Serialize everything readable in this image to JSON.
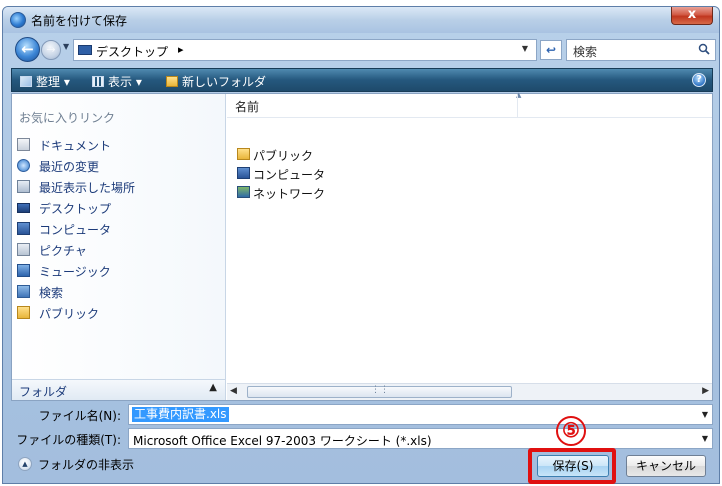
{
  "window": {
    "title": "名前を付けて保存",
    "close_label": "x"
  },
  "address": {
    "location": "デスクトップ",
    "search_placeholder": "検索"
  },
  "toolbar": {
    "organize": "整理",
    "view": "表示",
    "new_folder": "新しいフォルダ"
  },
  "navigation": {
    "header": "お気に入りリンク",
    "items": [
      {
        "label": "ドキュメント",
        "icon": "documents-icon"
      },
      {
        "label": "最近の変更",
        "icon": "recent-changes-icon"
      },
      {
        "label": "最近表示した場所",
        "icon": "recent-places-icon"
      },
      {
        "label": "デスクトップ",
        "icon": "desktop-icon"
      },
      {
        "label": "コンピュータ",
        "icon": "computer-icon"
      },
      {
        "label": "ピクチャ",
        "icon": "pictures-icon"
      },
      {
        "label": "ミュージック",
        "icon": "music-icon"
      },
      {
        "label": "検索",
        "icon": "search-icon"
      },
      {
        "label": "パブリック",
        "icon": "folder-icon"
      }
    ],
    "folders_label": "フォルダ"
  },
  "files": {
    "column_name": "名前",
    "items": [
      {
        "label": "パブリック",
        "icon": "folder-icon"
      },
      {
        "label": "コンピュータ",
        "icon": "computer-icon"
      },
      {
        "label": "ネットワーク",
        "icon": "network-icon"
      }
    ]
  },
  "form": {
    "filename_label": "ファイル名(N):",
    "filename_value": "工事費内訳書.xls",
    "filetype_label": "ファイルの種類(T):",
    "filetype_value": "Microsoft Office Excel 97-2003 ワークシート (*.xls)"
  },
  "footer": {
    "hide_folders": "フォルダの非表示",
    "save_button": "保存(S)",
    "cancel_button": "キャンセル",
    "step_marker": "⑤"
  },
  "colors": {
    "highlight_red": "#e01010",
    "selection_blue": "#3399ff",
    "toolbar_blue": "#25587e"
  }
}
